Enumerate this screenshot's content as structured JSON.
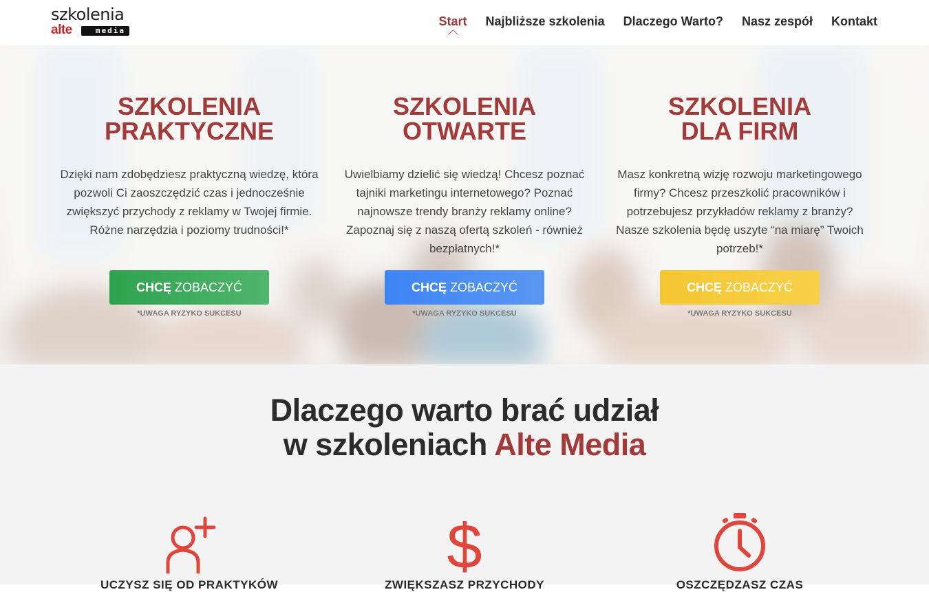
{
  "header": {
    "logo_top": "szkolenia",
    "logo_alte": "alte",
    "logo_media": "media",
    "nav": [
      {
        "label": "Start"
      },
      {
        "label": "Najbliższe szkolenia"
      },
      {
        "label": "Dlaczego Warto?"
      },
      {
        "label": "Nasz zespół"
      },
      {
        "label": "Kontakt"
      }
    ]
  },
  "hero": {
    "columns": [
      {
        "title_line1": "SZKOLENIA",
        "title_line2": "PRAKTYCZNE",
        "text": "Dzięki nam zdobędziesz praktyczną wiedzę, która pozwoli Ci zaoszczędzić czas i jednocześnie zwiększyć przychody z reklamy w Twojej firmie. Różne narzędzia i poziomy trudności!*",
        "cta_bold": "CHCĘ",
        "cta_rest": "ZOBACZYĆ",
        "note": "*UWAGA RYZYKO SUKCESU",
        "color": "#2ea24f"
      },
      {
        "title_line1": "SZKOLENIA",
        "title_line2": "OTWARTE",
        "text": "Uwielbiamy dzielić się wiedzą! Chcesz poznać tajniki marketingu internetowego? Poznać najnowsze trendy branży reklamy online? Zapoznaj się z naszą ofertą szkoleń - również bezpłatnych!*",
        "cta_bold": "CHCĘ",
        "cta_rest": "ZOBACZYĆ",
        "note": "*UWAGA RYZYKO SUKCESU",
        "color": "#3d84f5"
      },
      {
        "title_line1": "SZKOLENIA",
        "title_line2": "DLA FIRM",
        "text": "Masz konkretną wizję rozwoju marketingowego firmy? Chcesz przeszkolić pracowników i potrzebujesz przykładów reklamy z branży? Nasze szkolenia będę uszyte “na miarę” Twoich potrzeb!*",
        "cta_bold": "CHCĘ",
        "cta_rest": "ZOBACZYĆ",
        "note": "*UWAGA RYZYKO SUKCESU",
        "color": "#f6c632"
      }
    ]
  },
  "why": {
    "title_line1": "Dlaczego warto brać udział",
    "title_line2_prefix": "w szkoleniach ",
    "title_line2_accent": "Alte Media",
    "features": [
      {
        "icon": "add-user-icon",
        "label": "UCZYSZ SIĘ OD PRAKTYKÓW"
      },
      {
        "icon": "dollar-icon",
        "label": "ZWIĘKSZASZ PRZYCHODY"
      },
      {
        "icon": "stopwatch-icon",
        "label": "OSZCZĘDZASZ CZAS"
      }
    ],
    "accent_color": "#a23a3a",
    "icon_color": "#e0453b"
  }
}
